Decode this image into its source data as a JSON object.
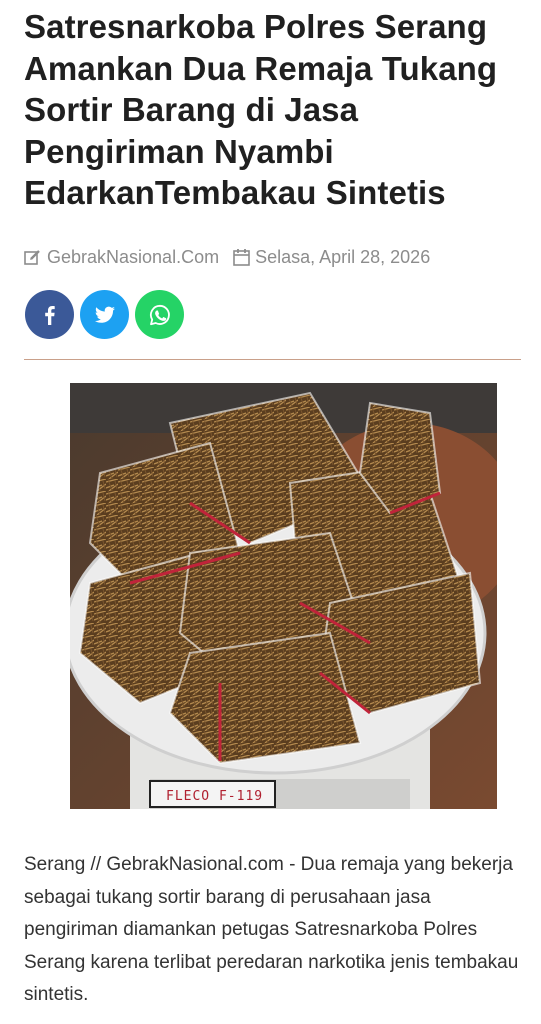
{
  "article": {
    "title": "Satresnarkoba Polres Serang Amankan Dua Remaja Tukang Sortir Barang di Jasa Pengiriman Nyambi EdarkanTembakau Sintetis",
    "source": "GebrakNasional.Com",
    "date": "Selasa, April 28, 2026",
    "body": "Serang // GebrakNasional.com - Dua remaja yang bekerja sebagai tukang sortir barang di perusahaan jasa pengiriman diamankan petugas Satresnarkoba Polres Serang karena terlibat peredaran narkotika jenis tembakau sintetis."
  },
  "meta_icons": {
    "source": "edit-icon",
    "date": "calendar-icon"
  },
  "share": [
    {
      "network": "facebook",
      "icon": "facebook-icon",
      "color": "#3b5998"
    },
    {
      "network": "twitter",
      "icon": "twitter-icon",
      "color": "#1da1f2"
    },
    {
      "network": "whatsapp",
      "icon": "whatsapp-icon",
      "color": "#25d366"
    }
  ],
  "photo": {
    "scale_label": "FLECO F-119"
  },
  "colors": {
    "divider": "#c9a08a",
    "meta_text": "#8c8c8c"
  }
}
